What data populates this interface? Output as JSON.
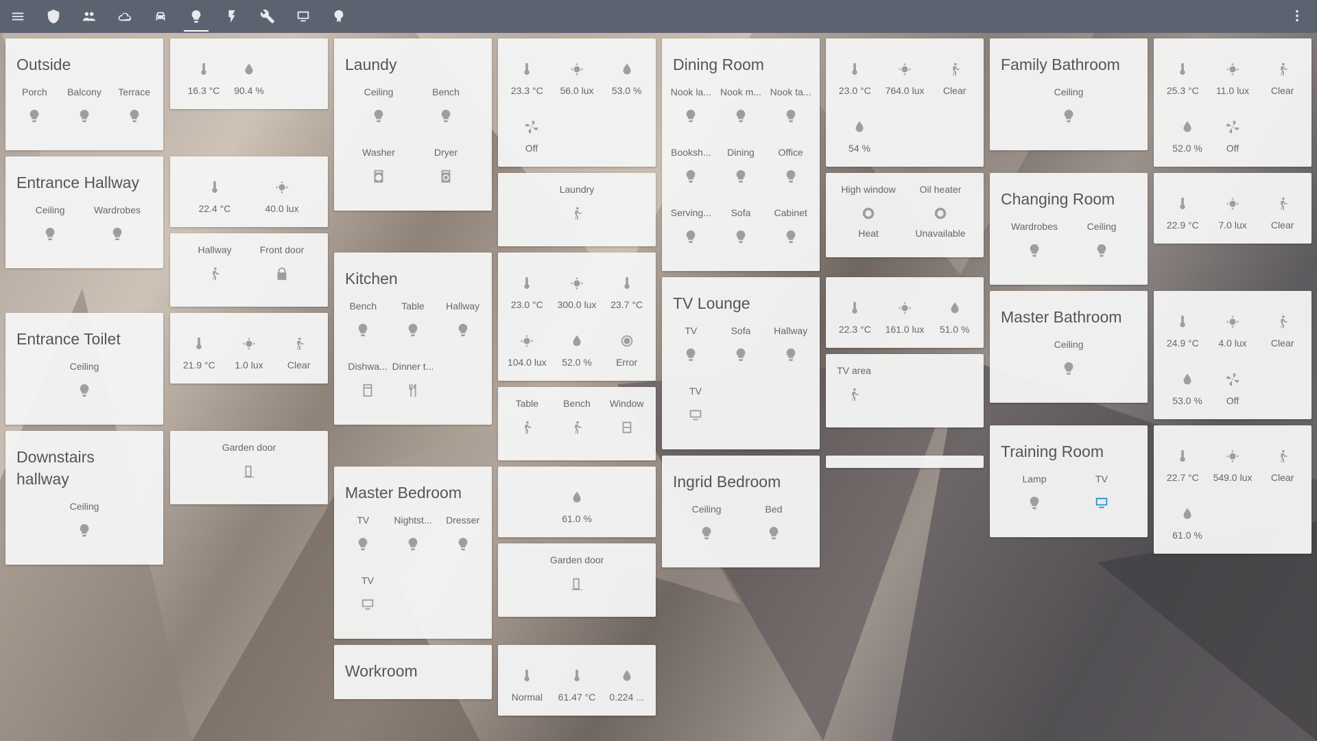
{
  "topbar": {
    "icons": [
      "menu-icon",
      "shield-icon",
      "people-icon",
      "cloud-icon",
      "car-icon",
      "lightbulb-icon",
      "flash-icon",
      "wrench-icon",
      "monitor-icon",
      "pin-icon"
    ],
    "active": "lightbulb-icon"
  },
  "rooms": {
    "outside": {
      "title": "Outside",
      "items": [
        "Porch",
        "Balcony",
        "Terrace"
      ]
    },
    "entrance_hallway": {
      "title": "Entrance Hallway",
      "items": [
        "Ceiling",
        "Wardrobes"
      ]
    },
    "entrance_toilet": {
      "title": "Entrance Toilet",
      "items": [
        "Ceiling"
      ]
    },
    "downstairs_hallway": {
      "title": "Downstairs hallway",
      "items": [
        "Ceiling"
      ]
    },
    "laundy": {
      "title": "Laundy",
      "items": [
        "Ceiling",
        "Bench",
        "Washer",
        "Dryer"
      ]
    },
    "kitchen": {
      "title": "Kitchen",
      "items": [
        "Bench",
        "Table",
        "Hallway",
        "Dishwa...",
        "Dinner t..."
      ]
    },
    "master_bedroom": {
      "title": "Master Bedroom",
      "items": [
        "TV",
        "Nightst...",
        "Dresser",
        "TV"
      ]
    },
    "workroom": {
      "title": "Workroom"
    },
    "dining_room": {
      "title": "Dining Room",
      "items": [
        "Nook la...",
        "Nook m...",
        "Nook ta...",
        "Booksh...",
        "Dining",
        "Office",
        "Serving...",
        "Sofa",
        "Cabinet"
      ]
    },
    "tv_lounge": {
      "title": "TV Lounge",
      "items": [
        "TV",
        "Sofa",
        "Hallway",
        "TV"
      ]
    },
    "ingrid_bedroom": {
      "title": "Ingrid Bedroom",
      "items": [
        "Ceiling",
        "Bed"
      ]
    },
    "family_bathroom": {
      "title": "Family Bathroom",
      "items": [
        "Ceiling"
      ]
    },
    "changing_room": {
      "title": "Changing Room",
      "items": [
        "Wardrobes",
        "Ceiling"
      ]
    },
    "master_bathroom": {
      "title": "Master Bathroom",
      "items": [
        "Ceiling"
      ]
    },
    "training_room": {
      "title": "Training Room",
      "items": [
        "Lamp",
        "TV"
      ]
    }
  },
  "sensors": {
    "outside": [
      "16.3 °C",
      "90.4 %"
    ],
    "entrance": [
      "22.4 °C",
      "40.0 lux"
    ],
    "entrance_binary": {
      "labels": [
        "Hallway",
        "Front door"
      ]
    },
    "toilet": [
      "21.9 °C",
      "1.0 lux",
      "Clear"
    ],
    "garden_door_a": {
      "label": "Garden door"
    },
    "laundy": [
      "23.3 °C",
      "56.0 lux",
      "53.0 %",
      "Off"
    ],
    "laundry_motion": {
      "label": "Laundry"
    },
    "kitchen": [
      "23.0 °C",
      "300.0 lux",
      "23.7 °C",
      "104.0 lux",
      "52.0 %",
      "Error"
    ],
    "kitchen_binary": {
      "labels": [
        "Table",
        "Bench",
        "Window"
      ]
    },
    "humidity61": [
      "61.0 %"
    ],
    "garden_door_b": {
      "label": "Garden door"
    },
    "workroom": [
      "Normal",
      "61.47 °C",
      "0.224 ..."
    ],
    "dining": [
      "23.0 °C",
      "764.0 lux",
      "Clear",
      "54 %"
    ],
    "climate": {
      "labels": [
        "High window",
        "Oil heater"
      ],
      "values": [
        "Heat",
        "Unavailable"
      ]
    },
    "tv_lounge": [
      "22.3 °C",
      "161.0 lux",
      "51.0 %"
    ],
    "tv_area": {
      "label": "TV area"
    },
    "family_bath": [
      "25.3 °C",
      "11.0 lux",
      "Clear",
      "52.0 %",
      "Off"
    ],
    "changing": [
      "22.9 °C",
      "7.0 lux",
      "Clear"
    ],
    "master_bath": [
      "24.9 °C",
      "4.0 lux",
      "Clear",
      "53.0 %",
      "Off"
    ],
    "training": [
      "22.7 °C",
      "549.0 lux",
      "Clear",
      "61.0 %"
    ]
  }
}
